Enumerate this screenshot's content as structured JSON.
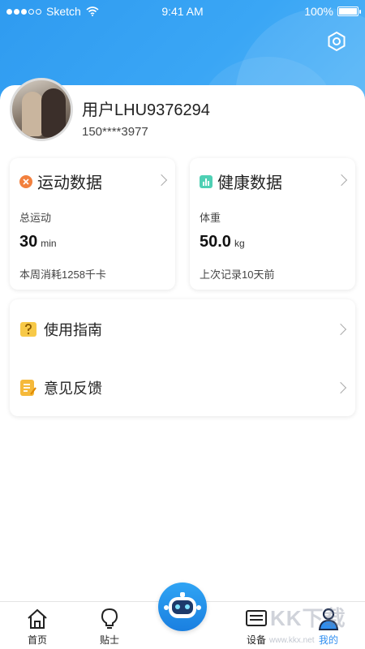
{
  "status_bar": {
    "carrier": "Sketch",
    "time": "9:41 AM",
    "battery": "100%"
  },
  "profile": {
    "name": "用户LHU9376294",
    "phone": "150****3977"
  },
  "stats": {
    "exercise": {
      "title": "运动数据",
      "label": "总运动",
      "value": "30",
      "unit": "min",
      "sub": "本周消耗1258千卡"
    },
    "health": {
      "title": "健康数据",
      "label": "体重",
      "value": "50.0",
      "unit": "kg",
      "sub": "上次记录10天前"
    }
  },
  "menu": {
    "guide": "使用指南",
    "feedback": "意见反馈"
  },
  "tabbar": {
    "home": "首页",
    "tips": "贴士",
    "device": "设备",
    "mine": "我的"
  },
  "watermark": {
    "text": "KK下载",
    "url": "www.kkx.net"
  },
  "colors": {
    "primary": "#2f9bf0",
    "active_tab": "#2f8ef0",
    "exercise_icon": "#f2803e",
    "health_icon": "#4fd0b4",
    "guide_icon": "#f7c948",
    "feedback_icon": "#f5b93a"
  },
  "icons": {
    "settings": "settings-hex-icon",
    "robot": "robot-icon",
    "home": "home-icon",
    "tips": "lightbulb-icon",
    "device": "device-icon",
    "mine": "person-icon"
  }
}
